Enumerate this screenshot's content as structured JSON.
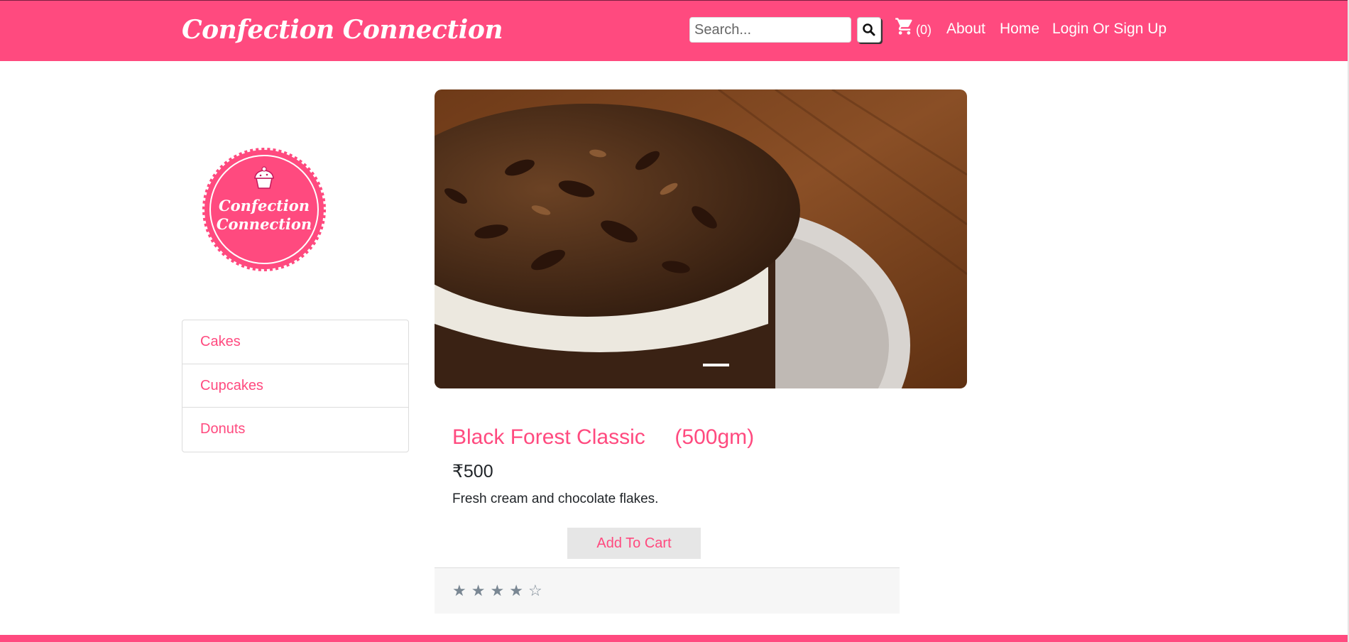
{
  "header": {
    "brand": "Confection Connection",
    "search_placeholder": "Search...",
    "cart_count": "(0)",
    "nav": [
      "About",
      "Home",
      "Login Or Sign Up"
    ]
  },
  "sidebar": {
    "logo_text_1": "Confection",
    "logo_text_2": "Connection",
    "categories": [
      "Cakes",
      "Cupcakes",
      "Donuts"
    ]
  },
  "product": {
    "title": "Black Forest Classic     (500gm)",
    "price": "₹500",
    "description": "Fresh cream and chocolate flakes.",
    "add_to_cart": "Add To Cart",
    "rating": 4,
    "rating_max": 5
  },
  "colors": {
    "brand_pink": "#ff4a7f",
    "star_gray": "#7a8793"
  }
}
